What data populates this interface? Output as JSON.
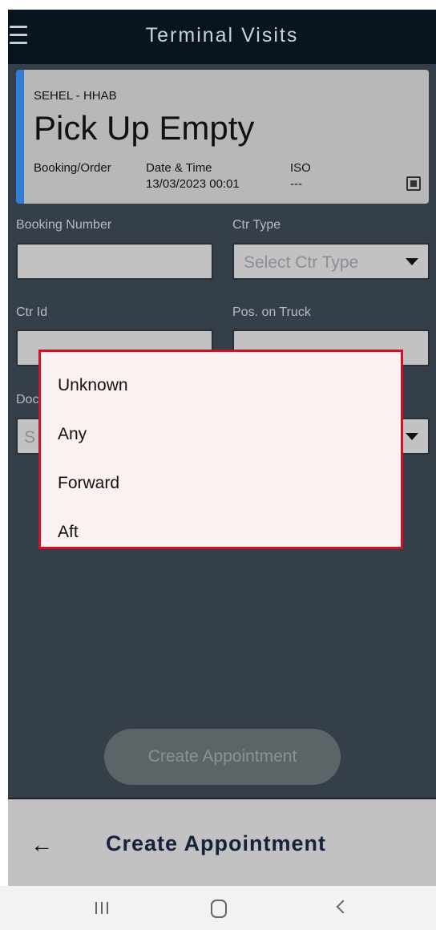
{
  "app_bar": {
    "title": "Terminal Visits"
  },
  "visit_card": {
    "location": "SEHEL - HHAB",
    "type": "Pick Up Empty",
    "booking_label": "Booking/Order",
    "datetime_label": "Date & Time",
    "datetime_value": "13/03/2023 00:01",
    "iso_label": "ISO",
    "iso_value": "---"
  },
  "form": {
    "booking_number_label": "Booking Number",
    "ctr_type_label": "Ctr Type",
    "ctr_type_placeholder": "Select Ctr Type",
    "ctr_id_label": "Ctr Id",
    "pos_on_truck_label": "Pos. on Truck",
    "partial_label_left": "Doc",
    "partial_select_left": "S"
  },
  "dropdown": {
    "options": [
      "Unknown",
      "Any",
      "Forward",
      "Aft"
    ]
  },
  "actions": {
    "create_button": "Create Appointment"
  },
  "bottom_bar": {
    "back_icon": "arrow-left-icon",
    "title": "Create Appointment"
  },
  "system_nav": {
    "recents": "recents-icon",
    "home": "home-icon",
    "back": "back-icon"
  },
  "colors": {
    "app_bar": "#081420",
    "background": "#353f4a",
    "card_accent": "#2f7fd6",
    "dropdown_border": "#d0102a"
  }
}
